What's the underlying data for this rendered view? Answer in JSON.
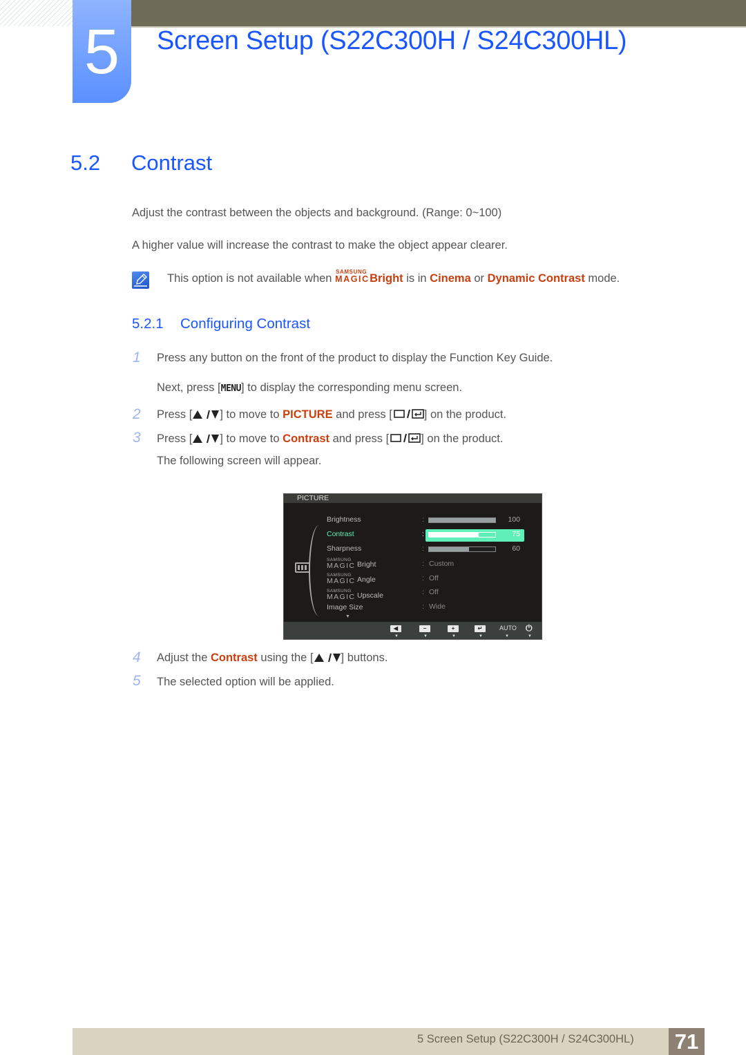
{
  "chapter": {
    "number": "5",
    "title": "Screen Setup (S22C300H / S24C300HL)"
  },
  "section": {
    "number": "5.2",
    "title": "Contrast",
    "paragraphs": [
      "Adjust the contrast between the objects and background. (Range: 0~100)",
      "A higher value will increase the contrast to make the object appear clearer."
    ],
    "note": {
      "icon": "note-pencil-icon",
      "prefix": "This option is not available when ",
      "magic_small": "SAMSUNG",
      "magic_large": "MAGIC",
      "bright": "Bright",
      "is_in": " is in ",
      "cinema": "Cinema",
      "or": " or ",
      "dynamic_contrast": "Dynamic Contrast",
      "suffix": " mode."
    }
  },
  "subsection": {
    "number": "5.2.1",
    "title": "Configuring Contrast"
  },
  "steps": {
    "s1": {
      "num": "1",
      "text": "Press any button on the front of the product to display the Function Key Guide."
    },
    "s1b": {
      "prefix": "Next, press [",
      "key": "MENU",
      "suffix": "] to display the corresponding menu screen."
    },
    "s2": {
      "num": "2",
      "a": "Press [",
      "b": "] to move to ",
      "target": "PICTURE",
      "c": " and press [",
      "d": "] on the product."
    },
    "s3": {
      "num": "3",
      "a": "Press [",
      "b": "] to move to ",
      "target": "Contrast",
      "c": " and press [",
      "d": "] on the product."
    },
    "s3b": {
      "text": "The following screen will appear."
    },
    "s4": {
      "num": "4",
      "a": "Adjust the ",
      "target": "Contrast",
      "b": " using the [",
      "c": "] buttons."
    },
    "s5": {
      "num": "5",
      "text": "The selected option will be applied."
    }
  },
  "osd": {
    "title": "PICTURE",
    "items": [
      {
        "label": "Brightness",
        "value": "100",
        "fraction": 1.0
      },
      {
        "label": "Contrast",
        "value": "75",
        "fraction": 0.75,
        "active": true
      },
      {
        "label": "Sharpness",
        "value": "60",
        "fraction": 0.6
      }
    ],
    "magic_small": "SAMSUNG",
    "magic_large": "MAGIC",
    "options": [
      {
        "label": "Bright",
        "value": "Custom"
      },
      {
        "label": "Angle",
        "value": "Off"
      },
      {
        "label": "Upscale",
        "value": "Off"
      },
      {
        "label": "Image Size",
        "value": "Wide"
      }
    ],
    "colon": ":",
    "function_keys": {
      "left": "◀",
      "minus": "−",
      "plus": "+",
      "enter": "↵",
      "auto": "AUTO",
      "power": "⏻",
      "arrow": "▼"
    },
    "colors": {
      "active": "#5ef0b8"
    }
  },
  "footer": {
    "text": "5 Screen Setup (S22C300H / S24C300HL)",
    "page": "71"
  },
  "colors": {
    "heading_blue": "#1a56ff",
    "highlight_orange": "#c8400f",
    "topbar": "#6e6c58",
    "footer_bar": "#d9d3c0",
    "page_badge": "#8d8173"
  }
}
